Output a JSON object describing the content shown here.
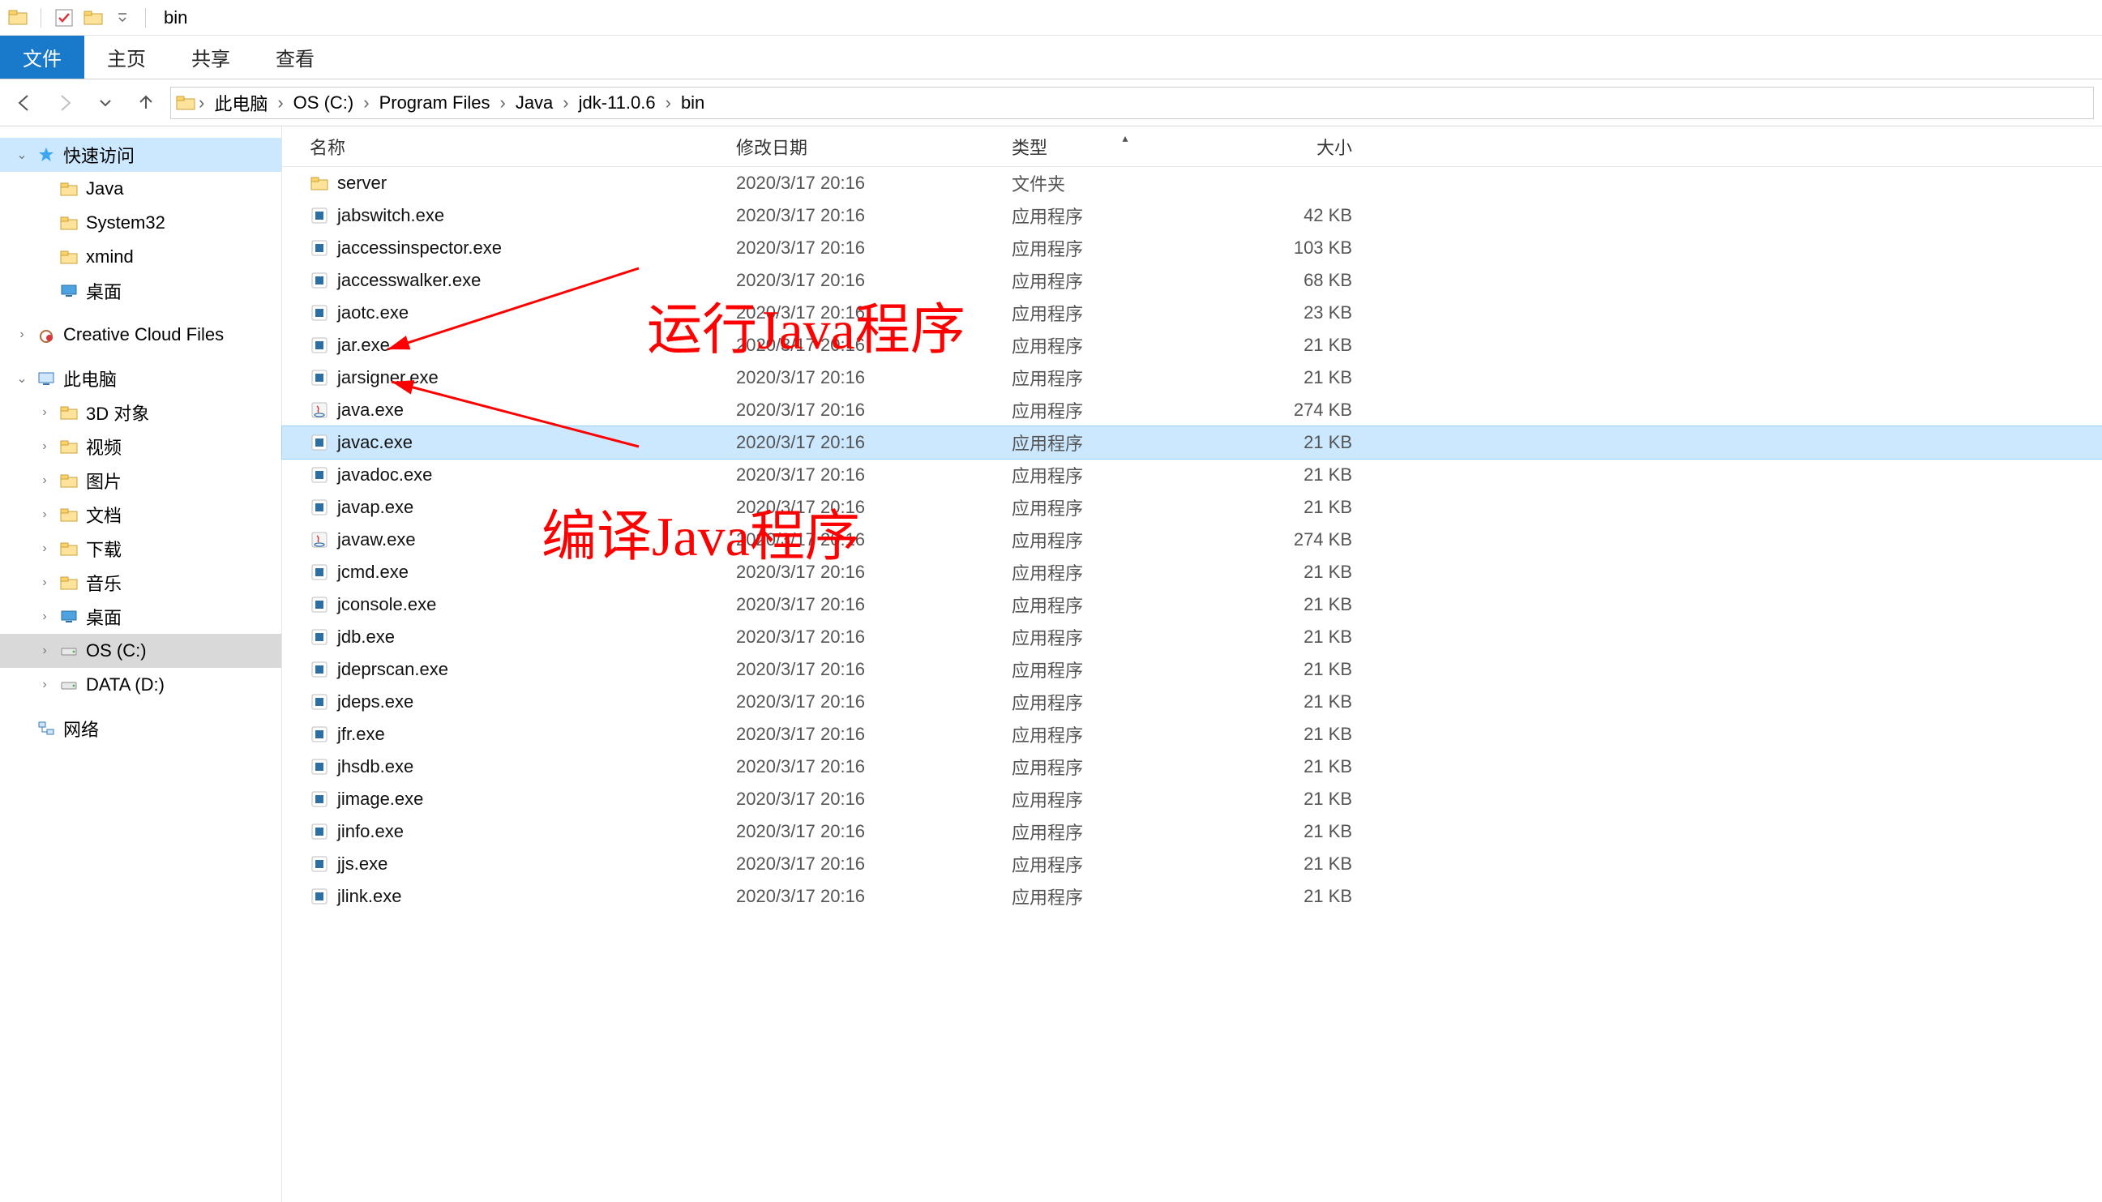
{
  "window": {
    "title": "bin"
  },
  "ribbon": {
    "file": "文件",
    "home": "主页",
    "share": "共享",
    "view": "查看"
  },
  "breadcrumb": {
    "items": [
      "此电脑",
      "OS (C:)",
      "Program Files",
      "Java",
      "jdk-11.0.6",
      "bin"
    ]
  },
  "sidebar": {
    "quick_access": {
      "label": "快速访问",
      "items": [
        {
          "label": "Java"
        },
        {
          "label": "System32"
        },
        {
          "label": "xmind"
        },
        {
          "label": "桌面"
        }
      ]
    },
    "creative_cloud": {
      "label": "Creative Cloud Files"
    },
    "this_pc": {
      "label": "此电脑",
      "items": [
        {
          "label": "3D 对象"
        },
        {
          "label": "视频"
        },
        {
          "label": "图片"
        },
        {
          "label": "文档"
        },
        {
          "label": "下载"
        },
        {
          "label": "音乐"
        },
        {
          "label": "桌面"
        },
        {
          "label": "OS (C:)",
          "selected": true
        },
        {
          "label": "DATA (D:)"
        }
      ]
    },
    "network": {
      "label": "网络"
    }
  },
  "columns": {
    "name": "名称",
    "date": "修改日期",
    "type": "类型",
    "size": "大小"
  },
  "type_labels": {
    "folder": "文件夹",
    "app": "应用程序"
  },
  "files": [
    {
      "icon": "folder",
      "name": "server",
      "date": "2020/3/17 20:16",
      "typekey": "folder",
      "size": ""
    },
    {
      "icon": "exe",
      "name": "jabswitch.exe",
      "date": "2020/3/17 20:16",
      "typekey": "app",
      "size": "42 KB"
    },
    {
      "icon": "exe",
      "name": "jaccessinspector.exe",
      "date": "2020/3/17 20:16",
      "typekey": "app",
      "size": "103 KB"
    },
    {
      "icon": "exe",
      "name": "jaccesswalker.exe",
      "date": "2020/3/17 20:16",
      "typekey": "app",
      "size": "68 KB"
    },
    {
      "icon": "exe",
      "name": "jaotc.exe",
      "date": "2020/3/17 20:16",
      "typekey": "app",
      "size": "23 KB"
    },
    {
      "icon": "exe",
      "name": "jar.exe",
      "date": "2020/3/17 20:16",
      "typekey": "app",
      "size": "21 KB"
    },
    {
      "icon": "exe",
      "name": "jarsigner.exe",
      "date": "2020/3/17 20:16",
      "typekey": "app",
      "size": "21 KB"
    },
    {
      "icon": "java",
      "name": "java.exe",
      "date": "2020/3/17 20:16",
      "typekey": "app",
      "size": "274 KB"
    },
    {
      "icon": "exe",
      "name": "javac.exe",
      "date": "2020/3/17 20:16",
      "typekey": "app",
      "size": "21 KB",
      "selected": true
    },
    {
      "icon": "exe",
      "name": "javadoc.exe",
      "date": "2020/3/17 20:16",
      "typekey": "app",
      "size": "21 KB"
    },
    {
      "icon": "exe",
      "name": "javap.exe",
      "date": "2020/3/17 20:16",
      "typekey": "app",
      "size": "21 KB"
    },
    {
      "icon": "java",
      "name": "javaw.exe",
      "date": "2020/3/17 20:16",
      "typekey": "app",
      "size": "274 KB"
    },
    {
      "icon": "exe",
      "name": "jcmd.exe",
      "date": "2020/3/17 20:16",
      "typekey": "app",
      "size": "21 KB"
    },
    {
      "icon": "exe",
      "name": "jconsole.exe",
      "date": "2020/3/17 20:16",
      "typekey": "app",
      "size": "21 KB"
    },
    {
      "icon": "exe",
      "name": "jdb.exe",
      "date": "2020/3/17 20:16",
      "typekey": "app",
      "size": "21 KB"
    },
    {
      "icon": "exe",
      "name": "jdeprscan.exe",
      "date": "2020/3/17 20:16",
      "typekey": "app",
      "size": "21 KB"
    },
    {
      "icon": "exe",
      "name": "jdeps.exe",
      "date": "2020/3/17 20:16",
      "typekey": "app",
      "size": "21 KB"
    },
    {
      "icon": "exe",
      "name": "jfr.exe",
      "date": "2020/3/17 20:16",
      "typekey": "app",
      "size": "21 KB"
    },
    {
      "icon": "exe",
      "name": "jhsdb.exe",
      "date": "2020/3/17 20:16",
      "typekey": "app",
      "size": "21 KB"
    },
    {
      "icon": "exe",
      "name": "jimage.exe",
      "date": "2020/3/17 20:16",
      "typekey": "app",
      "size": "21 KB"
    },
    {
      "icon": "exe",
      "name": "jinfo.exe",
      "date": "2020/3/17 20:16",
      "typekey": "app",
      "size": "21 KB"
    },
    {
      "icon": "exe",
      "name": "jjs.exe",
      "date": "2020/3/17 20:16",
      "typekey": "app",
      "size": "21 KB"
    },
    {
      "icon": "exe",
      "name": "jlink.exe",
      "date": "2020/3/17 20:16",
      "typekey": "app",
      "size": "21 KB"
    }
  ],
  "annotations": {
    "run": "运行Java程序",
    "compile": "编译Java程序"
  }
}
